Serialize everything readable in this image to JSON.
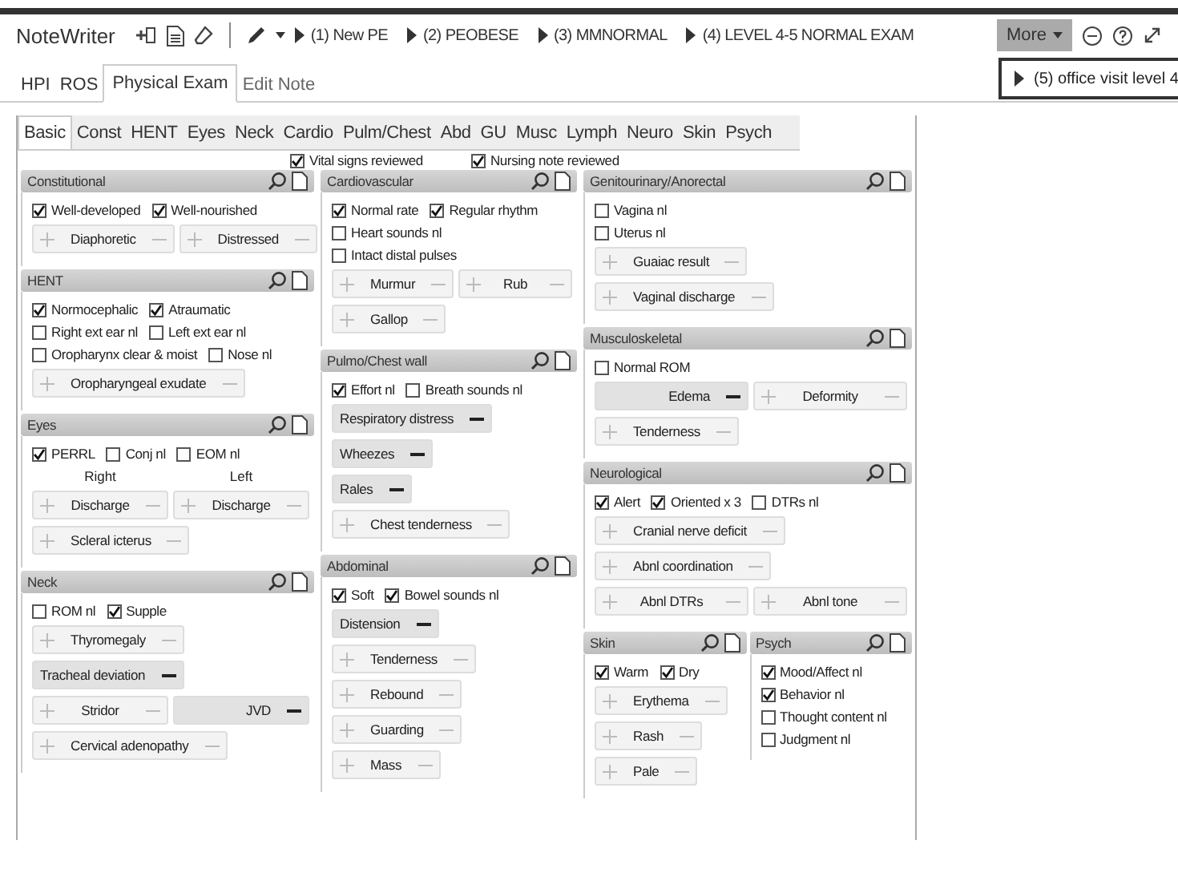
{
  "app": {
    "title": "NoteWriter"
  },
  "quick_notes": [
    {
      "label": "(1) New PE"
    },
    {
      "label": "(2) PEOBESE"
    },
    {
      "label": "(3) MMNORMAL"
    },
    {
      "label": "(4) LEVEL 4-5 NORMAL EXAM"
    }
  ],
  "more_button": {
    "label": "More"
  },
  "popup_note": {
    "label": "(5) office visit level 4"
  },
  "tabs": [
    {
      "label": "HPI",
      "selected": false
    },
    {
      "label": "ROS",
      "selected": false
    },
    {
      "label": "Physical Exam",
      "selected": true
    },
    {
      "label": "Edit Note",
      "selected": false
    }
  ],
  "subtabs": [
    {
      "label": "Basic",
      "selected": true
    },
    {
      "label": "Const",
      "selected": false
    },
    {
      "label": "HENT",
      "selected": false
    },
    {
      "label": "Eyes",
      "selected": false
    },
    {
      "label": "Neck",
      "selected": false
    },
    {
      "label": "Cardio",
      "selected": false
    },
    {
      "label": "Pulm/Chest",
      "selected": false
    },
    {
      "label": "Abd",
      "selected": false
    },
    {
      "label": "GU",
      "selected": false
    },
    {
      "label": "Musc",
      "selected": false
    },
    {
      "label": "Lymph",
      "selected": false
    },
    {
      "label": "Neuro",
      "selected": false
    },
    {
      "label": "Skin",
      "selected": false
    },
    {
      "label": "Psych",
      "selected": false
    }
  ],
  "reviewed": [
    {
      "label": "Vital signs reviewed",
      "checked": true
    },
    {
      "label": "Nursing note reviewed",
      "checked": true
    }
  ],
  "columns": [
    [
      {
        "title": "Constitutional",
        "rows": [
          {
            "items": [
              {
                "kind": "check",
                "label": "Well-developed",
                "checked": true
              },
              {
                "kind": "check",
                "label": "Well-nourished",
                "checked": true
              }
            ]
          },
          {
            "items": [
              {
                "kind": "toggle",
                "label": "Diaphoretic",
                "negative": false
              },
              {
                "kind": "toggle",
                "label": "Distressed",
                "negative": false
              }
            ]
          }
        ]
      },
      {
        "title": "HENT",
        "rows": [
          {
            "items": [
              {
                "kind": "check",
                "label": "Normocephalic",
                "checked": true
              },
              {
                "kind": "check",
                "label": "Atraumatic",
                "checked": true
              }
            ]
          },
          {
            "items": [
              {
                "kind": "check",
                "label": "Right ext ear nl",
                "checked": false
              },
              {
                "kind": "check",
                "label": "Left ext ear nl",
                "checked": false
              }
            ]
          },
          {
            "items": [
              {
                "kind": "check",
                "label": "Oropharynx clear & moist",
                "checked": false
              },
              {
                "kind": "check",
                "label": "Nose nl",
                "checked": false
              }
            ]
          },
          {
            "items": [
              {
                "kind": "toggle",
                "label": "Oropharyngeal exudate",
                "negative": false
              }
            ]
          }
        ]
      },
      {
        "title": "Eyes",
        "rows": [
          {
            "items": [
              {
                "kind": "check",
                "label": "PERRL",
                "checked": true
              },
              {
                "kind": "check",
                "label": "Conj nl",
                "checked": false
              },
              {
                "kind": "check",
                "label": "EOM nl",
                "checked": false
              }
            ]
          },
          {
            "items": [
              {
                "kind": "caption",
                "label": "Right"
              },
              {
                "kind": "caption",
                "label": "Left"
              }
            ]
          },
          {
            "items": [
              {
                "kind": "toggle",
                "label": "Discharge",
                "negative": false
              },
              {
                "kind": "toggle",
                "label": "Discharge",
                "negative": false
              }
            ]
          },
          {
            "items": [
              {
                "kind": "toggle",
                "label": "Scleral icterus",
                "negative": false
              }
            ]
          }
        ]
      },
      {
        "title": "Neck",
        "rows": [
          {
            "items": [
              {
                "kind": "check",
                "label": "ROM nl",
                "checked": false
              },
              {
                "kind": "check",
                "label": "Supple",
                "checked": true
              }
            ]
          },
          {
            "items": [
              {
                "kind": "toggle",
                "label": "Thyromegaly",
                "negative": false
              }
            ]
          },
          {
            "items": [
              {
                "kind": "toggle",
                "label": "Tracheal deviation",
                "negative": true
              }
            ]
          },
          {
            "items": [
              {
                "kind": "toggle",
                "label": "Stridor",
                "negative": false
              },
              {
                "kind": "toggle",
                "label": "JVD",
                "negative": true
              }
            ]
          },
          {
            "items": [
              {
                "kind": "toggle",
                "label": "Cervical adenopathy",
                "negative": false
              }
            ]
          }
        ]
      }
    ],
    [
      {
        "title": "Cardiovascular",
        "rows": [
          {
            "items": [
              {
                "kind": "check",
                "label": "Normal rate",
                "checked": true
              },
              {
                "kind": "check",
                "label": "Regular rhythm",
                "checked": true
              }
            ]
          },
          {
            "items": [
              {
                "kind": "check",
                "label": "Heart sounds nl",
                "checked": false
              }
            ]
          },
          {
            "items": [
              {
                "kind": "check",
                "label": "Intact distal pulses",
                "checked": false
              }
            ]
          },
          {
            "items": [
              {
                "kind": "toggle",
                "label": "Murmur",
                "negative": false
              },
              {
                "kind": "toggle",
                "label": "Rub",
                "negative": false
              }
            ]
          },
          {
            "items": [
              {
                "kind": "toggle",
                "label": "Gallop",
                "negative": false
              }
            ]
          }
        ]
      },
      {
        "title": "Pulmo/Chest wall",
        "rows": [
          {
            "items": [
              {
                "kind": "check",
                "label": "Effort nl",
                "checked": true
              },
              {
                "kind": "check",
                "label": "Breath sounds nl",
                "checked": false
              }
            ]
          },
          {
            "items": [
              {
                "kind": "toggle",
                "label": "Respiratory distress",
                "negative": true
              }
            ]
          },
          {
            "items": [
              {
                "kind": "toggle",
                "label": "Wheezes",
                "negative": true
              }
            ]
          },
          {
            "items": [
              {
                "kind": "toggle",
                "label": "Rales",
                "negative": true
              }
            ]
          },
          {
            "items": [
              {
                "kind": "toggle",
                "label": "Chest tenderness",
                "negative": false
              }
            ]
          }
        ]
      },
      {
        "title": "Abdominal",
        "rows": [
          {
            "items": [
              {
                "kind": "check",
                "label": "Soft",
                "checked": true
              },
              {
                "kind": "check",
                "label": "Bowel sounds nl",
                "checked": true
              }
            ]
          },
          {
            "items": [
              {
                "kind": "toggle",
                "label": "Distension",
                "negative": true
              }
            ]
          },
          {
            "items": [
              {
                "kind": "toggle",
                "label": "Tenderness",
                "negative": false
              }
            ]
          },
          {
            "items": [
              {
                "kind": "toggle",
                "label": "Rebound",
                "negative": false
              }
            ]
          },
          {
            "items": [
              {
                "kind": "toggle",
                "label": "Guarding",
                "negative": false
              }
            ]
          },
          {
            "items": [
              {
                "kind": "toggle",
                "label": "Mass",
                "negative": false
              }
            ]
          }
        ]
      }
    ],
    [
      {
        "title": "Genitourinary/Anorectal",
        "rows": [
          {
            "items": [
              {
                "kind": "check",
                "label": "Vagina nl",
                "checked": false
              }
            ]
          },
          {
            "items": [
              {
                "kind": "check",
                "label": "Uterus nl",
                "checked": false
              }
            ]
          },
          {
            "items": [
              {
                "kind": "toggle",
                "label": "Guaiac result",
                "negative": false
              }
            ]
          },
          {
            "items": [
              {
                "kind": "toggle",
                "label": "Vaginal discharge",
                "negative": false
              }
            ]
          }
        ]
      },
      {
        "title": "Musculoskeletal",
        "rows": [
          {
            "items": [
              {
                "kind": "check",
                "label": "Normal ROM",
                "checked": false
              }
            ]
          },
          {
            "items": [
              {
                "kind": "toggle",
                "label": "Edema",
                "negative": true
              },
              {
                "kind": "toggle",
                "label": "Deformity",
                "negative": false
              }
            ]
          },
          {
            "items": [
              {
                "kind": "toggle",
                "label": "Tenderness",
                "negative": false
              }
            ]
          }
        ]
      },
      {
        "title": "Neurological",
        "rows": [
          {
            "items": [
              {
                "kind": "check",
                "label": "Alert",
                "checked": true
              },
              {
                "kind": "check",
                "label": "Oriented x 3",
                "checked": true
              },
              {
                "kind": "check",
                "label": "DTRs nl",
                "checked": false
              }
            ]
          },
          {
            "items": [
              {
                "kind": "toggle",
                "label": "Cranial nerve deficit",
                "negative": false
              }
            ]
          },
          {
            "items": [
              {
                "kind": "toggle",
                "label": "Abnl coordination",
                "negative": false
              }
            ]
          },
          {
            "items": [
              {
                "kind": "toggle",
                "label": "Abnl DTRs",
                "negative": false
              },
              {
                "kind": "toggle",
                "label": "Abnl tone",
                "negative": false
              }
            ]
          }
        ]
      }
    ]
  ],
  "bottom_sections": [
    {
      "title": "Skin",
      "rows": [
        {
          "items": [
            {
              "kind": "check",
              "label": "Warm",
              "checked": true
            },
            {
              "kind": "check",
              "label": "Dry",
              "checked": true
            }
          ]
        },
        {
          "items": [
            {
              "kind": "toggle",
              "label": "Erythema",
              "negative": false
            }
          ]
        },
        {
          "items": [
            {
              "kind": "toggle",
              "label": "Rash",
              "negative": false
            }
          ]
        },
        {
          "items": [
            {
              "kind": "toggle",
              "label": "Pale",
              "negative": false
            }
          ]
        }
      ]
    },
    {
      "title": "Psych",
      "rows": [
        {
          "items": [
            {
              "kind": "check",
              "label": "Mood/Affect nl",
              "checked": true
            }
          ]
        },
        {
          "items": [
            {
              "kind": "check",
              "label": "Behavior nl",
              "checked": true
            }
          ]
        },
        {
          "items": [
            {
              "kind": "check",
              "label": "Thought content nl",
              "checked": false
            }
          ]
        },
        {
          "items": [
            {
              "kind": "check",
              "label": "Judgment nl",
              "checked": false
            }
          ]
        }
      ]
    }
  ]
}
